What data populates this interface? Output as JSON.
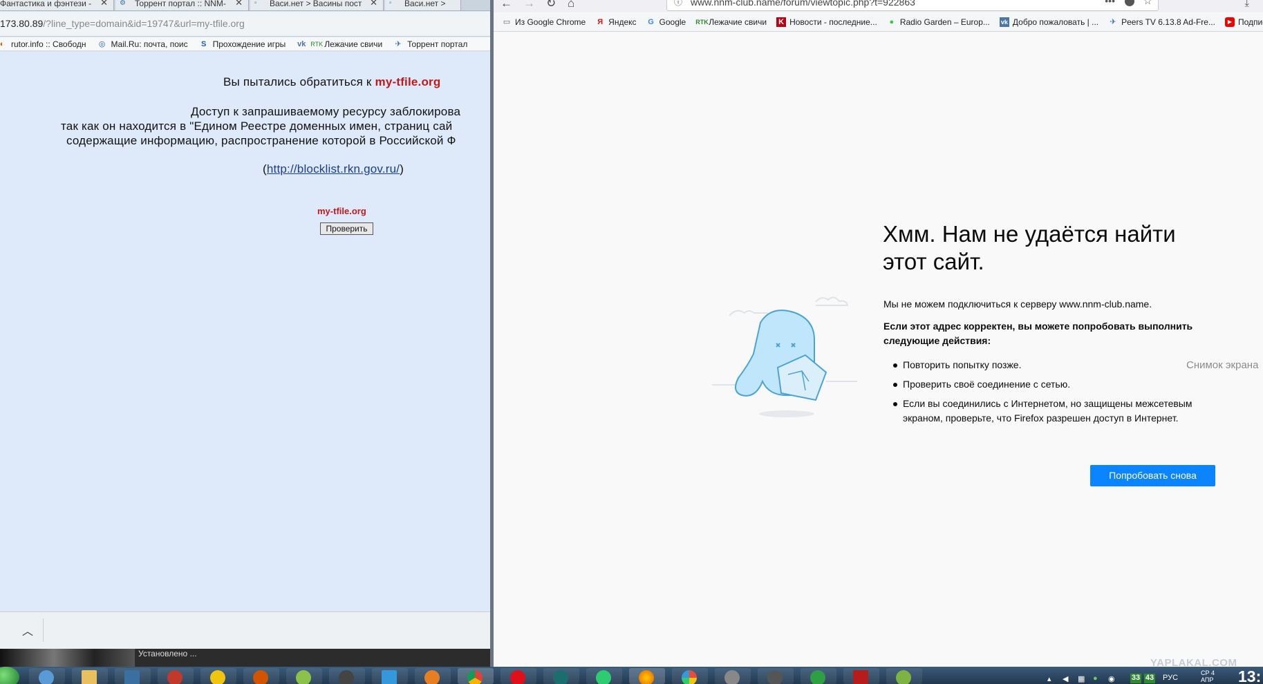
{
  "left_browser": {
    "tabs": [
      {
        "icon": "tfile",
        "label": "Фантастика и фэнтези -"
      },
      {
        "icon": "nnm",
        "label": "Торрент портал :: NNM-"
      },
      {
        "icon": "vasi",
        "label": "Васи.нет > Васины пост"
      },
      {
        "icon": "vasi",
        "label": "Васи.нет >"
      }
    ],
    "address": {
      "host": "173.80.89",
      "path": "/?line_type=domain&id=19747&url=my-tfile.org"
    },
    "bookmarks": [
      {
        "icon": "rutor",
        "label": "rutor.info :: Свободн"
      },
      {
        "icon": "mail",
        "label": "Mail.Ru: почта, поис"
      },
      {
        "icon": "s",
        "label": "Прохождение игры"
      },
      {
        "icon": "vk",
        "label": "Лежачие свичи"
      },
      {
        "icon": "nnm",
        "label": "Торрент портал"
      }
    ],
    "block_page": {
      "line1_prefix": "Вы пытались обратиться к ",
      "line1_domain": "my-tfile.org",
      "line2": "Доступ к запрашиваемому ресурсу заблокирова",
      "line3": "так как он находится в \"Едином Реестре доменных имен, страниц сай",
      "line4": "содержащие информацию, распространение которой в Российской Ф",
      "link_open": "(",
      "link": "http://blocklist.rkn.gov.ru/",
      "link_close": ")",
      "check_domain": "my-tfile.org",
      "check_button": "Проверить"
    },
    "download_chevron": "^",
    "shelf_text": "Установлено ..."
  },
  "right_browser": {
    "url": "www.nnm-club.name/forum/viewtopic.php?t=922863",
    "bookmarks": [
      {
        "icon": "folder",
        "label": "Из Google Chrome"
      },
      {
        "icon": "yandex",
        "label": "Яндекс"
      },
      {
        "icon": "google",
        "label": "Google"
      },
      {
        "icon": "rtk",
        "label": "Лежачие свичи"
      },
      {
        "icon": "kommersant",
        "label": "Новости - последние..."
      },
      {
        "icon": "radio",
        "label": "Radio Garden – Europ..."
      },
      {
        "icon": "vk",
        "label": "Добро пожаловать | ..."
      },
      {
        "icon": "peers",
        "label": "Peers TV 6.13.8 Ad-Fre..."
      },
      {
        "icon": "youtube",
        "label": "Подписки"
      }
    ],
    "error": {
      "title": "Хмм. Нам не удаётся найти этот сайт.",
      "description": "Мы не можем подключиться к серверу www.nnm-club.name.",
      "suggestion_heading": "Если этот адрес корректен, вы можете попробовать выполнить следующие действия:",
      "suggestions": [
        "Повторить попытку позже.",
        "Проверить своё соединение с сетью.",
        "Если вы соединились с Интернетом, но защищены межсетевым экраном, проверьте, что Firefox разрешен доступ в Интернет."
      ],
      "retry_button": "Попробовать снова"
    },
    "overlay_text": "Снимок экрана"
  },
  "taskbar": {
    "language": "РУС",
    "tray_num_1": "33",
    "tray_num_2": "43",
    "date": "СР 4 АПР",
    "time": "13:"
  },
  "watermark": "YAPLAKAL.COM",
  "colors": {
    "blocked_domain": "#c21818",
    "link": "#1b3d8f",
    "firefox_button": "#0a84ff",
    "taskbar": "#22384f"
  }
}
